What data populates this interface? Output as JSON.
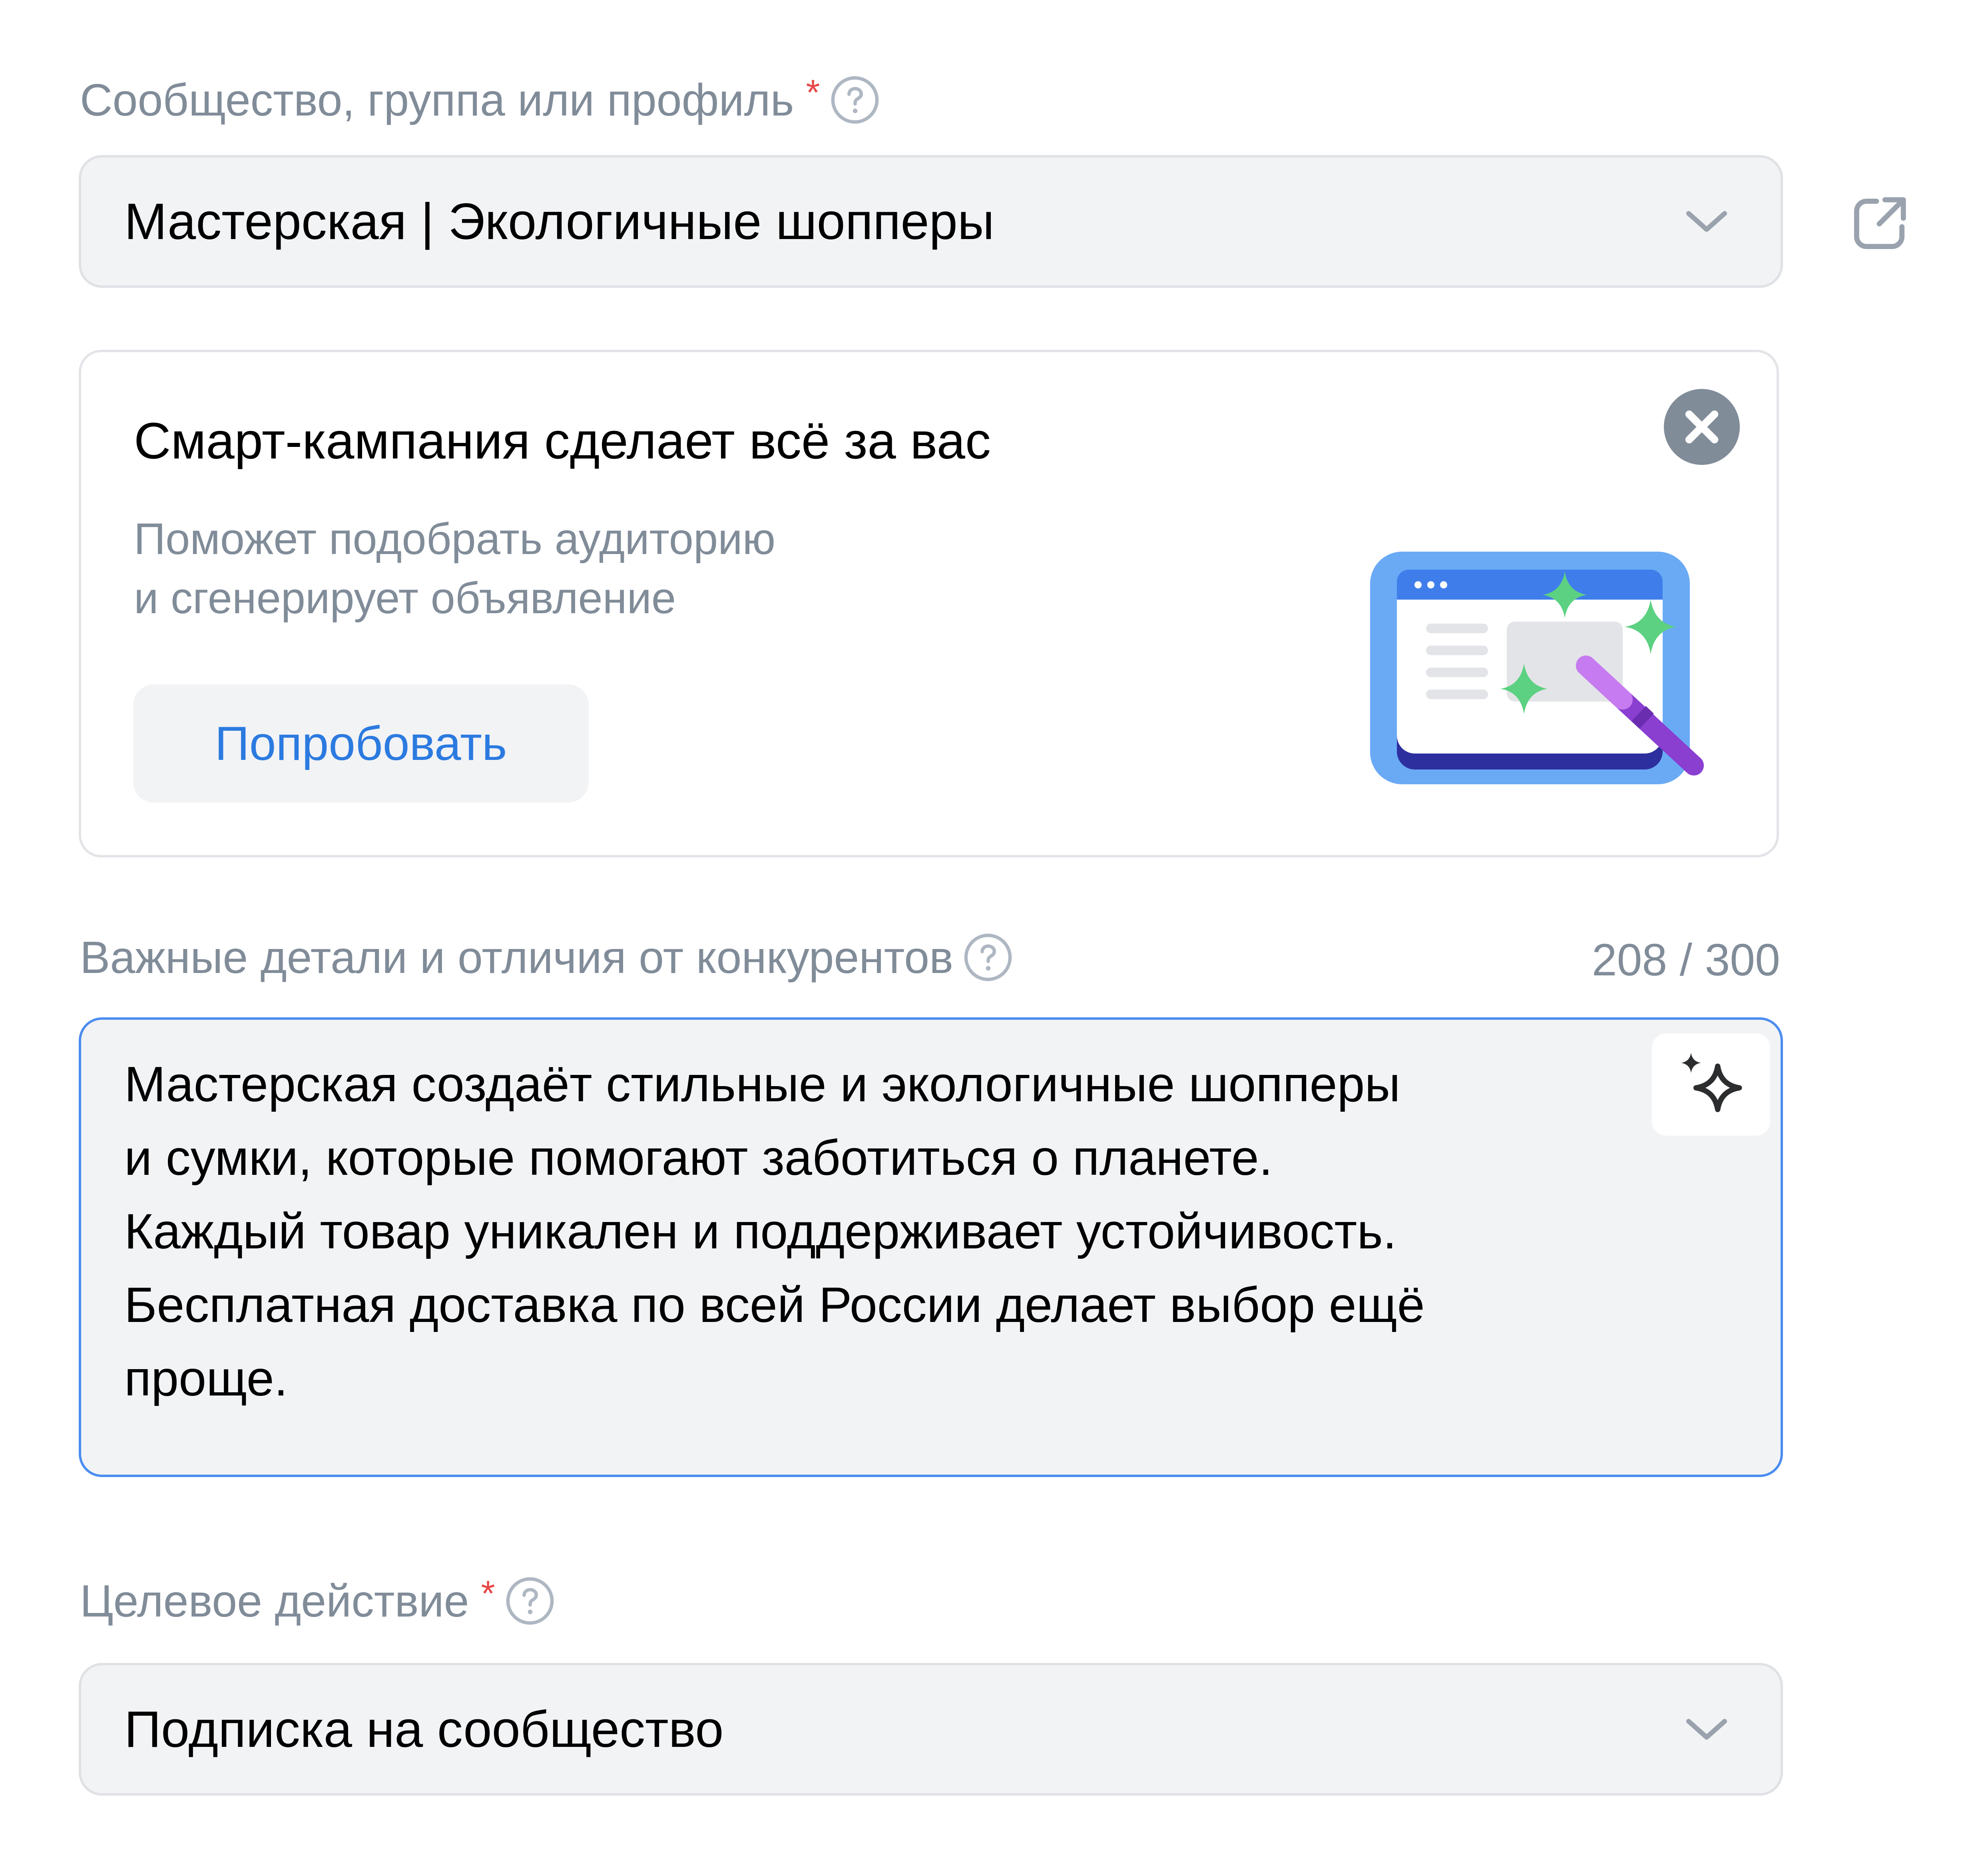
{
  "community_field": {
    "label": "Сообщество, группа или профиль",
    "required_mark": "*",
    "selected_value": "Мастерская | Экологичные шопперы"
  },
  "smart_campaign_card": {
    "title": "Смарт-кампания сделает всё за вас",
    "description_line1": "Поможет подобрать аудиторию",
    "description_line2": "и сгенерирует объявление",
    "try_button_label": "Попробовать"
  },
  "details_field": {
    "label": "Важные детали и отличия от конкурентов",
    "counter": "208 / 300",
    "text_lines": [
      "Мастерская создаёт стильные и экологичные шопперы",
      "и сумки, которые помогают заботиться о планете.",
      "Каждый товар уникален и поддерживает устойчивость.",
      "Бесплатная доставка по всей России делает выбор ещё",
      "проще."
    ]
  },
  "target_action_field": {
    "label": "Целевое действие",
    "required_mark": "*",
    "selected_value": "Подписка на сообщество"
  },
  "colors": {
    "accent": "#2b7ae0",
    "focus_border": "#4b8cf0",
    "label_gray": "#818c99",
    "required_red": "#e64646",
    "field_background": "#f2f3f5",
    "sparkle_green": "#5cd181",
    "wand_purple": "#8a3fd1"
  },
  "icons": {
    "help": "help-circle-icon",
    "dropdown": "chevron-down-icon",
    "external": "external-link-icon",
    "close": "close-circle-icon",
    "ai": "sparkles-icon",
    "illustration": "magic-wand-browser-illustration"
  }
}
